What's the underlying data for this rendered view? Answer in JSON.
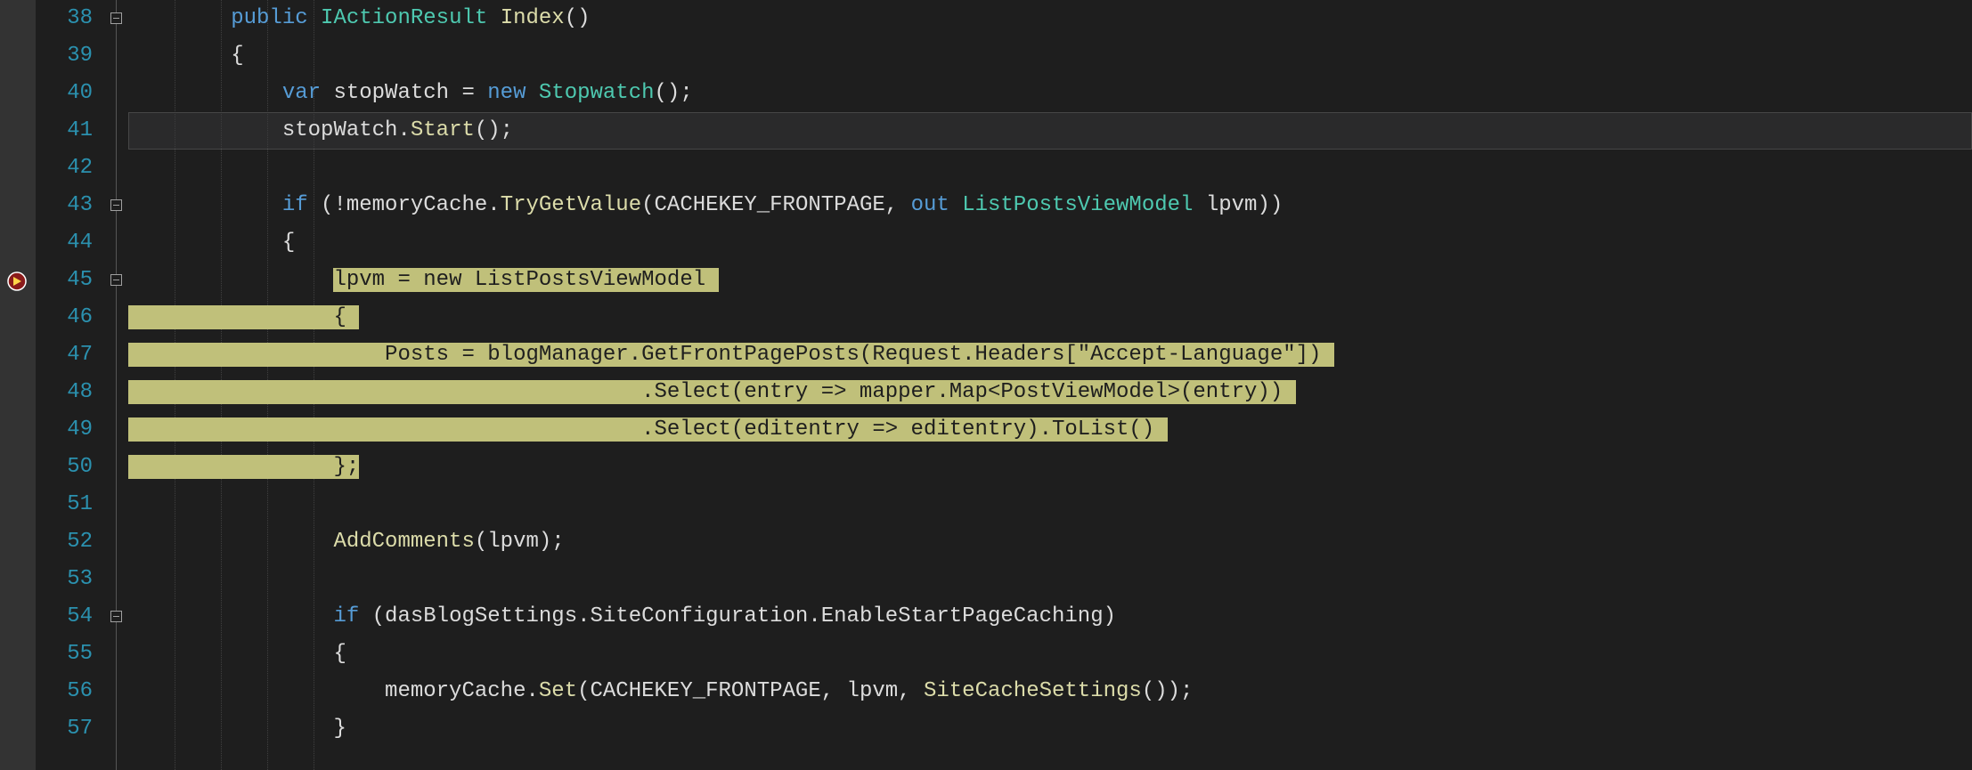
{
  "line_start": 38,
  "line_end": 57,
  "breakpoint_line": 45,
  "current_line": 41,
  "fold_lines": [
    38,
    43,
    45,
    54
  ],
  "colors": {
    "background": "#1e1e1e",
    "line_number": "#2b91af",
    "keyword": "#569cd6",
    "type": "#4ec9b0",
    "method": "#dcdcaa",
    "string": "#d69d85",
    "highlight_bg": "#c0c07a",
    "breakpoint": "#e51400"
  },
  "code": {
    "38": [
      {
        "t": "        ",
        "c": "punc"
      },
      {
        "t": "public ",
        "c": "kw"
      },
      {
        "t": "IActionResult ",
        "c": "type"
      },
      {
        "t": "Index",
        "c": "method"
      },
      {
        "t": "()",
        "c": "punc"
      }
    ],
    "39": [
      {
        "t": "        {",
        "c": "punc"
      }
    ],
    "40": [
      {
        "t": "            ",
        "c": "punc"
      },
      {
        "t": "var ",
        "c": "kw"
      },
      {
        "t": "stopWatch ",
        "c": "ident"
      },
      {
        "t": "= ",
        "c": "punc"
      },
      {
        "t": "new ",
        "c": "kw"
      },
      {
        "t": "Stopwatch",
        "c": "type"
      },
      {
        "t": "();",
        "c": "punc"
      }
    ],
    "41": [
      {
        "t": "            stopWatch.",
        "c": "ident"
      },
      {
        "t": "Start",
        "c": "method"
      },
      {
        "t": "();",
        "c": "punc"
      }
    ],
    "42": [
      {
        "t": "",
        "c": "punc"
      }
    ],
    "43": [
      {
        "t": "            ",
        "c": "punc"
      },
      {
        "t": "if ",
        "c": "kw"
      },
      {
        "t": "(!memoryCache.",
        "c": "ident"
      },
      {
        "t": "TryGetValue",
        "c": "method"
      },
      {
        "t": "(CACHEKEY_FRONTPAGE, ",
        "c": "ident"
      },
      {
        "t": "out ",
        "c": "kw"
      },
      {
        "t": "ListPostsViewModel ",
        "c": "type"
      },
      {
        "t": "lpvm",
        "c": "ident"
      },
      {
        "t": "))",
        "c": "punc"
      }
    ],
    "44": [
      {
        "t": "            {",
        "c": "punc"
      }
    ],
    "45": [
      {
        "t": "                ",
        "c": "punc",
        "hl_lead": true
      },
      {
        "t": "lpvm = ",
        "c": "ident",
        "hl": true
      },
      {
        "t": "new ",
        "c": "kw",
        "hl": true
      },
      {
        "t": "ListPostsViewModel ",
        "c": "type",
        "hl": true
      }
    ],
    "46": [
      {
        "t": "                ",
        "c": "punc",
        "hl_lead": true
      },
      {
        "t": "{ ",
        "c": "punc",
        "hl": true
      }
    ],
    "47": [
      {
        "t": "                ",
        "c": "punc",
        "hl_lead": true
      },
      {
        "t": "    Posts = blogManager.GetFrontPagePosts(Request.Headers[",
        "c": "ident",
        "hl": true
      },
      {
        "t": "\"Accept-Language\"",
        "c": "str",
        "hl": true
      },
      {
        "t": "]) ",
        "c": "punc",
        "hl": true
      }
    ],
    "48": [
      {
        "t": "                ",
        "c": "punc",
        "hl_lead": true
      },
      {
        "t": "                        .Select(entry => mapper.Map<PostViewModel>(entry)) ",
        "c": "ident",
        "hl": true
      }
    ],
    "49": [
      {
        "t": "                ",
        "c": "punc",
        "hl_lead": true
      },
      {
        "t": "                        .Select(editentry => editentry).ToList() ",
        "c": "ident",
        "hl": true
      }
    ],
    "50": [
      {
        "t": "                ",
        "c": "punc",
        "hl_lead": true
      },
      {
        "t": "};",
        "c": "punc",
        "hl": true
      }
    ],
    "51": [
      {
        "t": "",
        "c": "punc"
      }
    ],
    "52": [
      {
        "t": "                ",
        "c": "punc"
      },
      {
        "t": "AddComments",
        "c": "method"
      },
      {
        "t": "(lpvm);",
        "c": "ident"
      }
    ],
    "53": [
      {
        "t": "",
        "c": "punc"
      }
    ],
    "54": [
      {
        "t": "                ",
        "c": "punc"
      },
      {
        "t": "if ",
        "c": "kw"
      },
      {
        "t": "(dasBlogSettings.SiteConfiguration.EnableStartPageCaching)",
        "c": "ident"
      }
    ],
    "55": [
      {
        "t": "                {",
        "c": "punc"
      }
    ],
    "56": [
      {
        "t": "                    memoryCache.",
        "c": "ident"
      },
      {
        "t": "Set",
        "c": "method"
      },
      {
        "t": "(CACHEKEY_FRONTPAGE, lpvm, ",
        "c": "ident"
      },
      {
        "t": "SiteCacheSettings",
        "c": "method"
      },
      {
        "t": "());",
        "c": "punc"
      }
    ],
    "57": [
      {
        "t": "                }",
        "c": "punc"
      }
    ]
  },
  "highlight_lead_start": 46,
  "highlight_lead_end": 50
}
